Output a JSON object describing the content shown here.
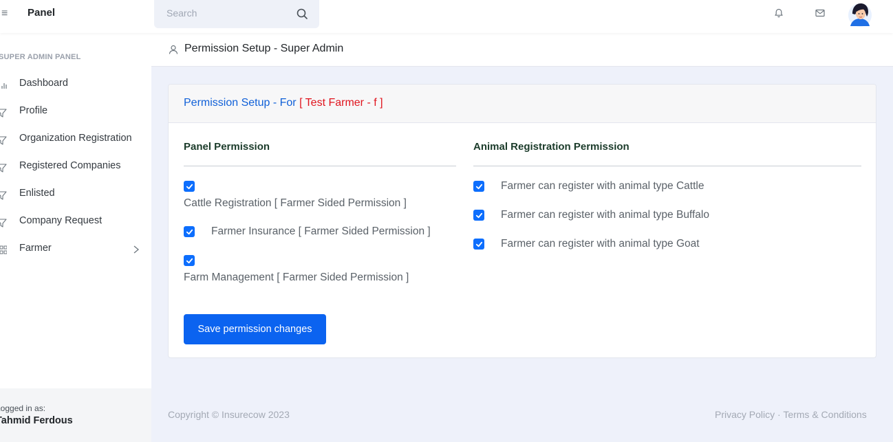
{
  "topbar": {
    "brand": "Panel",
    "search_placeholder": "Search"
  },
  "sidebar": {
    "heading": "SUPER ADMIN PANEL",
    "items": [
      {
        "label": "Dashboard",
        "icon": "bar-chart-icon"
      },
      {
        "label": "Profile",
        "icon": "filter-icon"
      },
      {
        "label": "Organization Registration",
        "icon": "filter-icon"
      },
      {
        "label": "Registered Companies",
        "icon": "filter-icon"
      },
      {
        "label": "Enlisted",
        "icon": "filter-icon"
      },
      {
        "label": "Company Request",
        "icon": "filter-icon"
      },
      {
        "label": "Farmer",
        "icon": "grid-icon"
      }
    ],
    "logged_in_label": "Logged in as:",
    "user_name": "Tahmid Ferdous"
  },
  "page": {
    "title": "Permission Setup - Super Admin"
  },
  "card": {
    "title_prefix": "Permission Setup - For",
    "title_target": "[ Test Farmer - f ]",
    "panel_permission": {
      "heading": "Panel Permission",
      "options": [
        {
          "label": "Cattle Registration [ Farmer Sided Permission ]",
          "checked": true
        },
        {
          "label": "Farmer Insurance [ Farmer Sided Permission ]",
          "checked": true
        },
        {
          "label": "Farm Management [ Farmer Sided Permission ]",
          "checked": true
        }
      ]
    },
    "animal_permission": {
      "heading": "Animal Registration Permission",
      "options": [
        {
          "label": "Farmer can register with animal type Cattle",
          "checked": true
        },
        {
          "label": "Farmer can register with animal type Buffalo",
          "checked": true
        },
        {
          "label": "Farmer can register with animal type Goat",
          "checked": true
        }
      ]
    },
    "save_label": "Save permission changes"
  },
  "footer": {
    "copyright": "Copyright © Insurecow 2023",
    "links": "Privacy Policy · Terms & Conditions"
  },
  "colors": {
    "primary": "#0b63f0",
    "target_red": "#e0141e",
    "title_blue": "#1060d8"
  }
}
